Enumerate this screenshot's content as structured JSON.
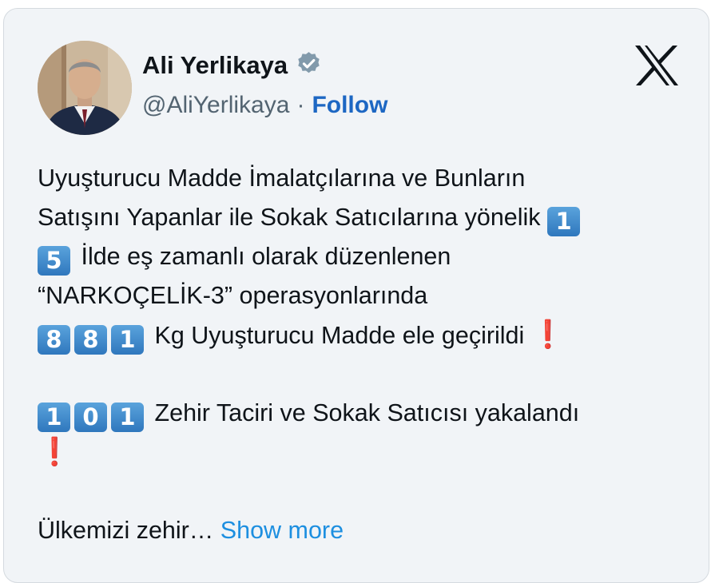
{
  "author": {
    "name": "Ali Yerlikaya",
    "handle": "@AliYerlikaya",
    "separator": "·",
    "follow_label": "Follow",
    "verified_icon": "verified-badge-icon"
  },
  "brand": {
    "logo": "x-logo-icon"
  },
  "tweet": {
    "line1": "Uyuşturucu Madde İmalatçılarına ve Bunların",
    "line2_text": "Satışını Yapanlar ile Sokak Satıcılarına yönelik ",
    "line2_key": "1",
    "line3_key": "5",
    "line3_text": " İlde eş zamanlı olarak düzenlenen",
    "line4": "“NARKOÇELİK-3” operasyonlarında",
    "line5_keys": [
      "8",
      "8",
      "1"
    ],
    "line5_text": " Kg Uyuşturucu Madde ele geçirildi ",
    "line6_keys": [
      "1",
      "0",
      "1"
    ],
    "line6_text": " Zehir Taciri ve Sokak Satıcısı yakalandı",
    "exclamation": "❗",
    "truncated_text": "Ülkemizi zehir… ",
    "show_more_label": "Show more"
  },
  "colors": {
    "card_bg": "#f1f4f7",
    "link": "#1d67c3",
    "show_more": "#1d8fe0",
    "keycap": "#3a84c9",
    "exclamation": "#d3212c"
  }
}
